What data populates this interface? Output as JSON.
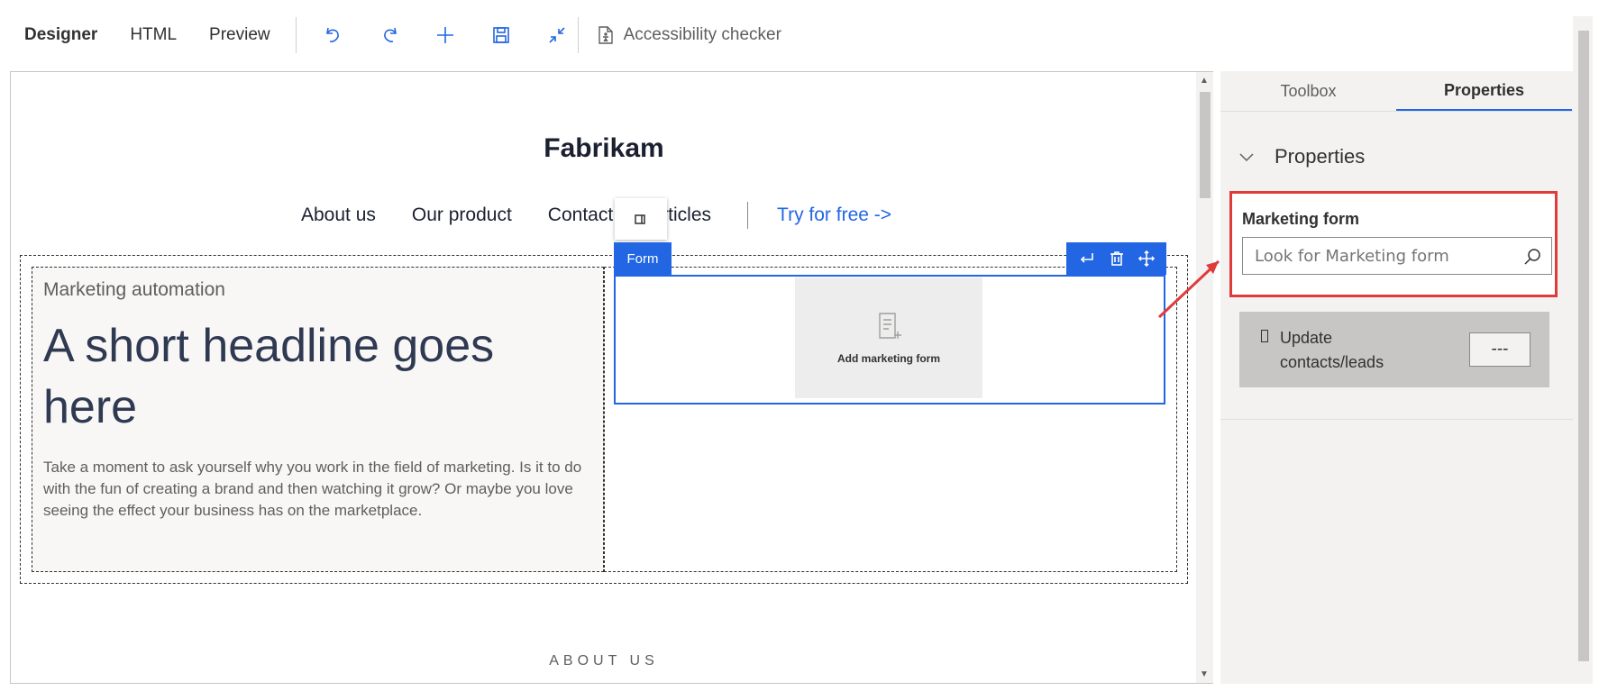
{
  "toolbar": {
    "tabs": [
      {
        "label": "Designer",
        "active": true
      },
      {
        "label": "HTML",
        "active": false
      },
      {
        "label": "Preview",
        "active": false
      }
    ],
    "icons": [
      "undo-icon",
      "redo-icon",
      "add-icon",
      "save-icon",
      "collapse-icon"
    ],
    "accessibility_label": "Accessibility checker"
  },
  "canvas": {
    "brand": "Fabrikam",
    "nav": {
      "items": [
        "About us",
        "Our product",
        "Contact",
        "Articles"
      ],
      "cta": "Try for free ->"
    },
    "kicker": "Marketing automation",
    "headline": "A short headline goes here",
    "body": "Take a moment to ask yourself why you work in the field of marketing. Is it to do with the fun of creating a brand and then watching it grow? Or maybe you love seeing the effect your business has on the marketplace.",
    "form_tag": "Form",
    "form_placeholder": "Add marketing form",
    "about_heading": "ABOUT US"
  },
  "pane": {
    "tabs": [
      {
        "label": "Toolbox",
        "active": false
      },
      {
        "label": "Properties",
        "active": true
      }
    ],
    "section_title": "Properties",
    "marketing_form": {
      "label": "Marketing form",
      "placeholder": "Look for Marketing form",
      "value": ""
    },
    "update": {
      "label": "Update contacts/leads",
      "value": "---"
    }
  },
  "colors": {
    "accent": "#2266e3",
    "highlight": "#e03b3b"
  }
}
